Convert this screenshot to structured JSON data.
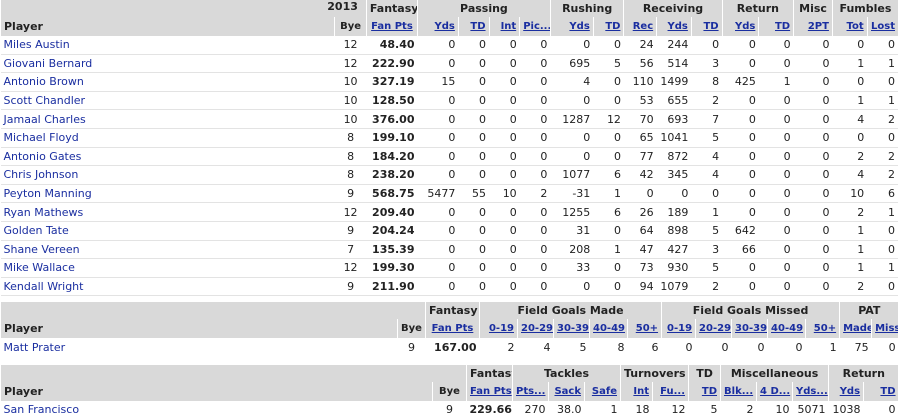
{
  "year": "2013",
  "offense": {
    "groups": [
      "Fantasy",
      "Passing",
      "Rushing",
      "Receiving",
      "Return",
      "Misc",
      "Fumbles"
    ],
    "columns": [
      "Player",
      "Bye",
      "Fan Pts",
      "Yds",
      "TD",
      "Int",
      "Pic...",
      "Yds",
      "TD",
      "Rec",
      "Yds",
      "TD",
      "Yds",
      "TD",
      "2PT",
      "Tot",
      "Lost"
    ],
    "rows": [
      [
        "Miles Austin",
        "12",
        "48.40",
        "0",
        "0",
        "0",
        "0",
        "0",
        "0",
        "24",
        "244",
        "0",
        "0",
        "0",
        "0",
        "0",
        "0"
      ],
      [
        "Giovani Bernard",
        "12",
        "222.90",
        "0",
        "0",
        "0",
        "0",
        "695",
        "5",
        "56",
        "514",
        "3",
        "0",
        "0",
        "0",
        "1",
        "1"
      ],
      [
        "Antonio Brown",
        "10",
        "327.19",
        "15",
        "0",
        "0",
        "0",
        "4",
        "0",
        "110",
        "1499",
        "8",
        "425",
        "1",
        "0",
        "0",
        "0"
      ],
      [
        "Scott Chandler",
        "10",
        "128.50",
        "0",
        "0",
        "0",
        "0",
        "0",
        "0",
        "53",
        "655",
        "2",
        "0",
        "0",
        "0",
        "1",
        "1"
      ],
      [
        "Jamaal Charles",
        "10",
        "376.00",
        "0",
        "0",
        "0",
        "0",
        "1287",
        "12",
        "70",
        "693",
        "7",
        "0",
        "0",
        "0",
        "4",
        "2"
      ],
      [
        "Michael Floyd",
        "8",
        "199.10",
        "0",
        "0",
        "0",
        "0",
        "0",
        "0",
        "65",
        "1041",
        "5",
        "0",
        "0",
        "0",
        "0",
        "0"
      ],
      [
        "Antonio Gates",
        "8",
        "184.20",
        "0",
        "0",
        "0",
        "0",
        "0",
        "0",
        "77",
        "872",
        "4",
        "0",
        "0",
        "0",
        "2",
        "2"
      ],
      [
        "Chris Johnson",
        "8",
        "238.20",
        "0",
        "0",
        "0",
        "0",
        "1077",
        "6",
        "42",
        "345",
        "4",
        "0",
        "0",
        "0",
        "4",
        "2"
      ],
      [
        "Peyton Manning",
        "9",
        "568.75",
        "5477",
        "55",
        "10",
        "2",
        "-31",
        "1",
        "0",
        "0",
        "0",
        "0",
        "0",
        "0",
        "10",
        "6"
      ],
      [
        "Ryan Mathews",
        "12",
        "209.40",
        "0",
        "0",
        "0",
        "0",
        "1255",
        "6",
        "26",
        "189",
        "1",
        "0",
        "0",
        "0",
        "2",
        "1"
      ],
      [
        "Golden Tate",
        "9",
        "204.24",
        "0",
        "0",
        "0",
        "0",
        "31",
        "0",
        "64",
        "898",
        "5",
        "642",
        "0",
        "0",
        "1",
        "0"
      ],
      [
        "Shane Vereen",
        "7",
        "135.39",
        "0",
        "0",
        "0",
        "0",
        "208",
        "1",
        "47",
        "427",
        "3",
        "66",
        "0",
        "0",
        "1",
        "0"
      ],
      [
        "Mike Wallace",
        "12",
        "199.30",
        "0",
        "0",
        "0",
        "0",
        "33",
        "0",
        "73",
        "930",
        "5",
        "0",
        "0",
        "0",
        "1",
        "1"
      ],
      [
        "Kendall Wright",
        "9",
        "211.90",
        "0",
        "0",
        "0",
        "0",
        "0",
        "0",
        "94",
        "1079",
        "2",
        "0",
        "0",
        "0",
        "2",
        "0"
      ]
    ]
  },
  "kicker": {
    "groups": [
      "Fantasy",
      "Field Goals Made",
      "Field Goals Missed",
      "PAT"
    ],
    "columns": [
      "Player",
      "Bye",
      "Fan Pts",
      "0-19",
      "20-29",
      "30-39",
      "40-49",
      "50+",
      "0-19",
      "20-29",
      "30-39",
      "40-49",
      "50+",
      "Made",
      "Miss"
    ],
    "rows": [
      [
        "Matt Prater",
        "9",
        "167.00",
        "2",
        "4",
        "5",
        "8",
        "6",
        "0",
        "0",
        "0",
        "0",
        "1",
        "75",
        "0"
      ]
    ]
  },
  "defense": {
    "groups": [
      "Fantasy",
      "Tackles",
      "Turnovers",
      "TD",
      "Miscellaneous",
      "Return"
    ],
    "columns": [
      "Player",
      "Bye",
      "Fan Pts",
      "Pts...",
      "Sack",
      "Safe",
      "Int",
      "Fu...",
      "TD",
      "Blk...",
      "4 D...",
      "Yds...",
      "Yds",
      "TD"
    ],
    "rows": [
      [
        "San Francisco",
        "9",
        "229.66",
        "270",
        "38.0",
        "1",
        "18",
        "12",
        "5",
        "2",
        "10",
        "5071",
        "1038",
        "0"
      ]
    ]
  }
}
